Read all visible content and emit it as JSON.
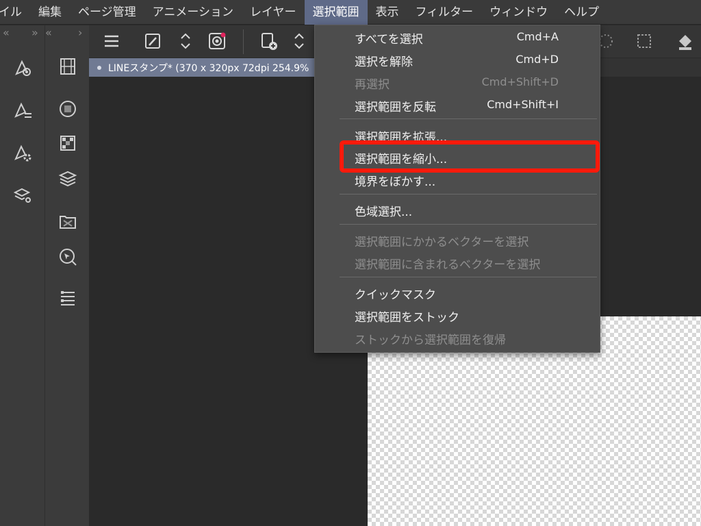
{
  "menubar": {
    "items": [
      "イル",
      "編集",
      "ページ管理",
      "アニメーション",
      "レイヤー",
      "選択範囲",
      "表示",
      "フィルター",
      "ウィンドウ",
      "ヘルプ"
    ],
    "active_index": 5
  },
  "panels": {
    "collapse_left": "«",
    "collapse_right": "»",
    "collapse_left2": "«",
    "collapse_right2": "›"
  },
  "document_tab": {
    "label": "LINEスタンプ* (370 x 320px 72dpi 254.9%"
  },
  "selection_menu": {
    "items": [
      {
        "label": "すべてを選択",
        "shortcut": "Cmd+A",
        "enabled": true
      },
      {
        "label": "選択を解除",
        "shortcut": "Cmd+D",
        "enabled": true
      },
      {
        "label": "再選択",
        "shortcut": "Cmd+Shift+D",
        "enabled": false
      },
      {
        "label": "選択範囲を反転",
        "shortcut": "Cmd+Shift+I",
        "enabled": true
      },
      {
        "label": "選択範囲を拡張...",
        "shortcut": "",
        "enabled": true
      },
      {
        "label": "選択範囲を縮小...",
        "shortcut": "",
        "enabled": true
      },
      {
        "label": "境界をぼかす...",
        "shortcut": "",
        "enabled": true
      },
      {
        "label": "色域選択...",
        "shortcut": "",
        "enabled": true
      },
      {
        "label": "選択範囲にかかるベクターを選択",
        "shortcut": "",
        "enabled": false
      },
      {
        "label": "選択範囲に含まれるベクターを選択",
        "shortcut": "",
        "enabled": false
      },
      {
        "label": "クイックマスク",
        "shortcut": "",
        "enabled": true
      },
      {
        "label": "選択範囲をストック",
        "shortcut": "",
        "enabled": true
      },
      {
        "label": "ストックから選択範囲を復帰",
        "shortcut": "",
        "enabled": false
      }
    ],
    "highlighted_item": "選択範囲を縮小..."
  },
  "colors": {
    "highlight_box": "#ff1a0b",
    "active_menu_bg": "#5f6a88",
    "menu_bg": "#4d4d4d"
  },
  "icons": {
    "tool_column": [
      "pen-target-icon",
      "pen-list-icon",
      "pen-settings-icon",
      "layers-settings-icon"
    ],
    "palette_column": [
      "filmstrip-icon",
      "color-circle-icon",
      "grid-swatch-icon",
      "layers-icon",
      "folder-pattern-icon",
      "navigator-icon",
      "list-properties-icon"
    ],
    "toolbar": [
      "menu-icon",
      "eyedropper-icon",
      "up-down-arrow-icon",
      "spiral-badge-icon",
      "new-page-icon",
      "up-down-arrow-icon"
    ]
  }
}
